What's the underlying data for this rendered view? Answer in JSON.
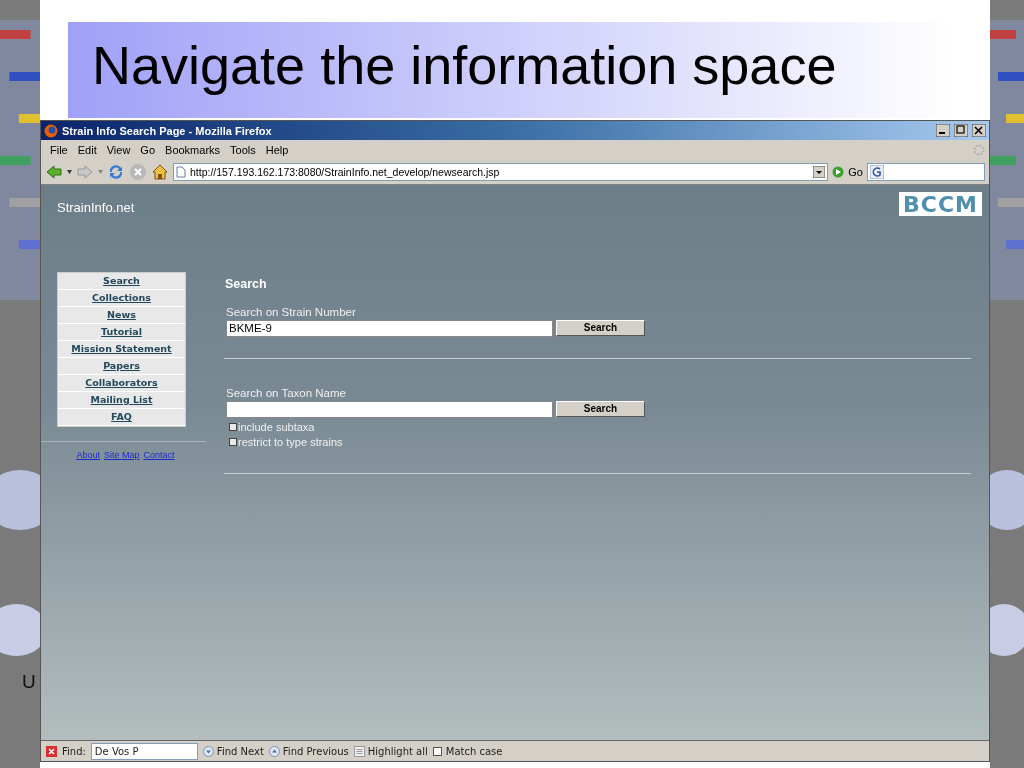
{
  "slide": {
    "title": "Navigate the information space",
    "footer_text": "U"
  },
  "window": {
    "title": "Strain Info Search Page - Mozilla Firefox"
  },
  "menu": [
    "File",
    "Edit",
    "View",
    "Go",
    "Bookmarks",
    "Tools",
    "Help"
  ],
  "address_bar": {
    "url": "http://157.193.162.173:8080/StrainInfo.net_develop/newsearch.jsp",
    "go_label": "Go"
  },
  "page": {
    "site_name": "StrainInfo.net",
    "logo": "BCCM",
    "nav": [
      "Search",
      "Collections",
      "News",
      "Tutorial",
      "Mission Statement",
      "Papers",
      "Collaborators",
      "Mailing List",
      "FAQ"
    ],
    "footer_links": [
      "About",
      "Site Map",
      "Contact"
    ],
    "heading": "Search",
    "sections": [
      {
        "label": "Search on Strain Number",
        "value": "BKME-9",
        "button": "Search"
      },
      {
        "label": "Search on Taxon Name",
        "button": "Search",
        "options": [
          {
            "label": "include subtaxa",
            "checked": false
          },
          {
            "label": "restrict to type strains",
            "checked": false
          }
        ]
      }
    ]
  },
  "find_bar": {
    "label": "Find:",
    "value": "De Vos P",
    "buttons": [
      {
        "kind": "next",
        "label": "Find Next"
      },
      {
        "kind": "previous",
        "label": "Find Previous"
      },
      {
        "kind": "highlight",
        "label": "Highlight all"
      }
    ],
    "match_case": {
      "label": "Match case",
      "checked": false
    }
  }
}
